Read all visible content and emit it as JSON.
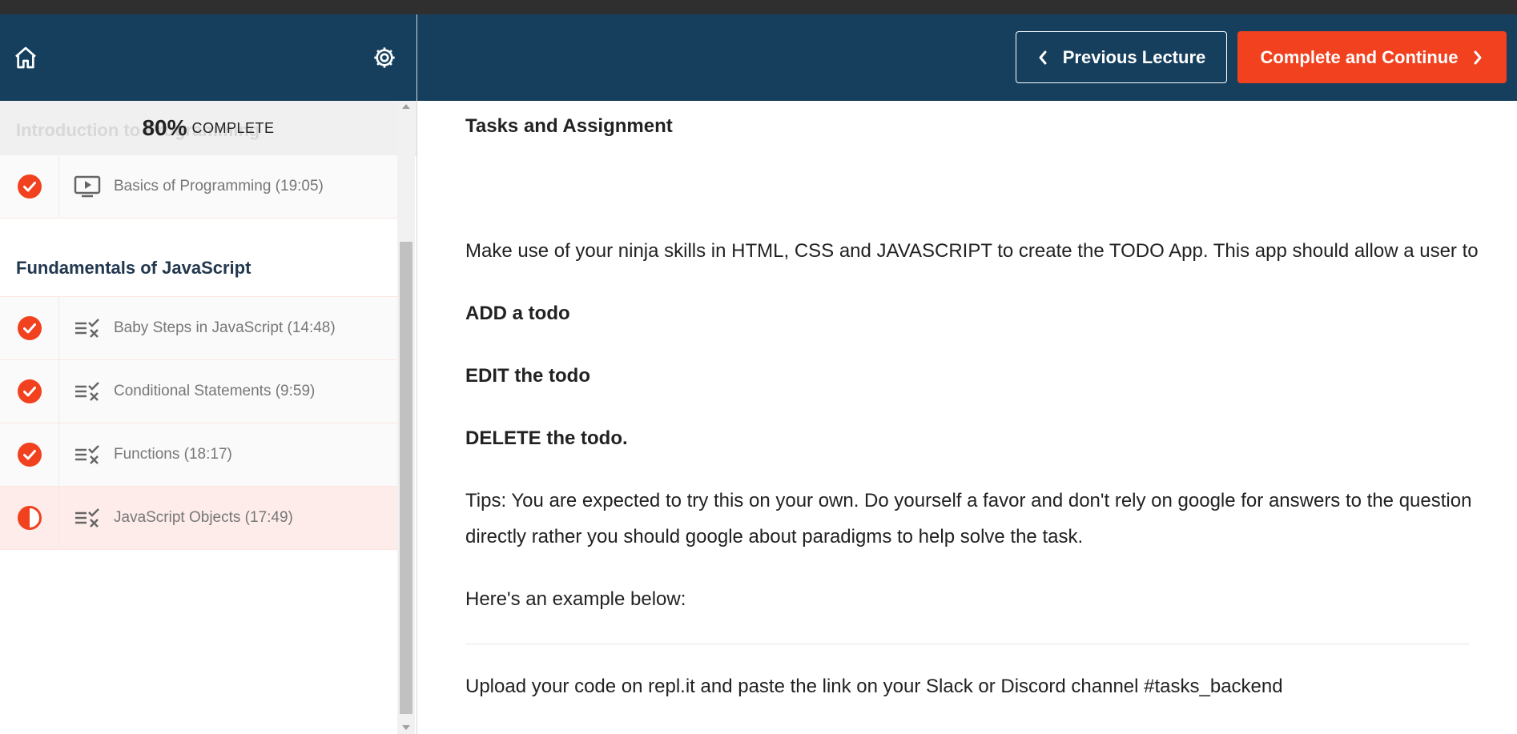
{
  "sidebar": {
    "progress_percent": "80%",
    "progress_label": "COMPLETE",
    "ghost_section": "Introduction to Programming",
    "first_item": {
      "label": "Basics of Programming (19:05)",
      "status": "complete",
      "type_icon": "video-icon"
    },
    "section_title": "Fundamentals of JavaScript",
    "items": [
      {
        "label": "Baby Steps in JavaScript (14:48)",
        "status": "complete",
        "type_icon": "quiz-icon"
      },
      {
        "label": "Conditional Statements (9:59)",
        "status": "complete",
        "type_icon": "quiz-icon"
      },
      {
        "label": "Functions (18:17)",
        "status": "complete",
        "type_icon": "quiz-icon"
      },
      {
        "label": "JavaScript Objects (17:49)",
        "status": "in-progress",
        "type_icon": "quiz-icon"
      }
    ]
  },
  "header": {
    "prev_label": "Previous Lecture",
    "next_label": "Complete and Continue"
  },
  "content": {
    "title": "Tasks and Assignment",
    "intro": "Make use of your ninja skills in HTML, CSS and JAVASCRIPT to create the TODO App. This app should allow a user to",
    "add": "ADD a todo",
    "edit": "EDIT the todo",
    "delete": "DELETE the todo.",
    "tips_line1": "Tips: You are expected to try this on your own. Do yourself a favor and don't rely on google for answers to the question",
    "tips_line2": "directly rather you should google about paradigms to help solve the task.",
    "example": "Here's an example below:",
    "upload": "Upload your code on repl.it and paste the link on your Slack or Discord channel #tasks_backend"
  },
  "colors": {
    "header_bg": "#163f5e",
    "accent": "#f1411e",
    "active_row": "#fdecea"
  }
}
